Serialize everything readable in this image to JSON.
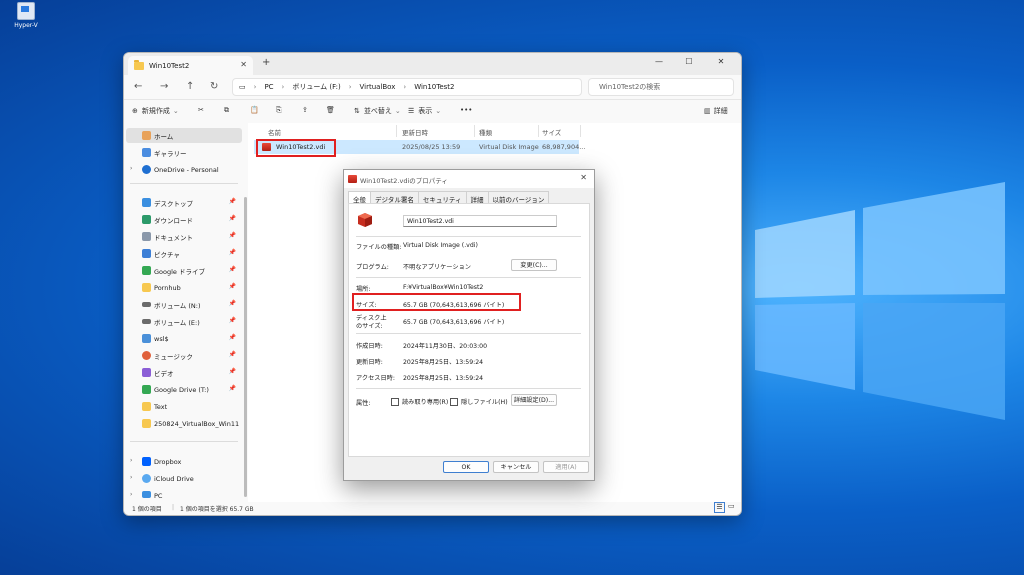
{
  "desktop": {
    "icon_label": "Hyper-V"
  },
  "explorer": {
    "tab_title": "Win10Test2",
    "address": {
      "parts": [
        "PC",
        "ボリューム (F:)",
        "VirtualBox",
        "Win10Test2"
      ]
    },
    "search_placeholder": "Win10Test2の検索",
    "toolbar": {
      "new": "新規作成",
      "sort": "並べ替え",
      "view": "表示",
      "more": "•••",
      "details": "詳細"
    },
    "nav": {
      "home": "ホーム",
      "gallery": "ギャラリー",
      "onedrive": "OneDrive - Personal",
      "items": [
        "デスクトップ",
        "ダウンロード",
        "ドキュメント",
        "ピクチャ",
        "Google ドライブ",
        "Pornhub",
        "ボリューム (N:)",
        "ボリューム (E:)",
        "wsl$",
        "ミュージック",
        "ビデオ",
        "Google Drive (T:)",
        "Text",
        "250824_VirtualBox_Win11"
      ],
      "dropbox": "Dropbox",
      "icloud": "iCloud Drive",
      "pc": "PC"
    },
    "columns": {
      "name": "名前",
      "modified": "更新日時",
      "type": "種類",
      "size": "サイズ"
    },
    "file": {
      "name": "Win10Test2.vdi",
      "modified": "2025/08/25 13:59",
      "type": "Virtual Disk Image",
      "size": "68,987,904..."
    },
    "status": {
      "count": "1 個の項目",
      "selected": "1 個の項目を選択 65.7 GB"
    }
  },
  "dialog": {
    "title": "Win10Test2.vdiのプロパティ",
    "tabs": [
      "全般",
      "デジタル署名",
      "セキュリティ",
      "詳細",
      "以前のバージョン"
    ],
    "filename": "Win10Test2.vdi",
    "type_label": "ファイルの種類:",
    "type_value": "Virtual Disk Image (.vdi)",
    "program_label": "プログラム:",
    "program_value": "不明なアプリケーション",
    "change_button": "変更(C)...",
    "location_label": "場所:",
    "location_value": "F:¥VirtualBox¥Win10Test2",
    "size_label": "サイズ:",
    "size_value": "65.7 GB (70,643,613,696 バイト)",
    "disk_size_label_1": "ディスク上",
    "disk_size_label_2": "のサイズ:",
    "disk_size_value": "65.7 GB (70,643,613,696 バイト)",
    "created_label": "作成日時:",
    "created_value": "2024年11月30日、20:03:00",
    "modified_label": "更新日時:",
    "modified_value": "2025年8月25日、13:59:24",
    "accessed_label": "アクセス日時:",
    "accessed_value": "2025年8月25日、13:59:24",
    "attr_label": "属性:",
    "readonly_label": "読み取り専用(R)",
    "hidden_label": "隠しファイル(H)",
    "advanced_button": "詳細設定(D)...",
    "ok": "OK",
    "cancel": "キャンセル",
    "apply": "適用(A)"
  }
}
